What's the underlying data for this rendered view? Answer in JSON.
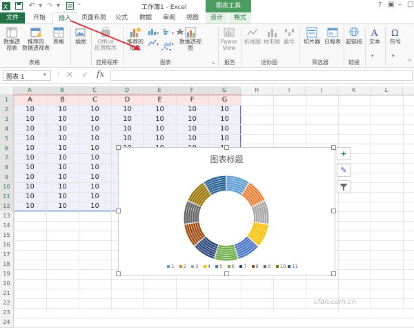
{
  "window": {
    "title": "工作簿1 - Excel",
    "context_tab_title": "图表工具"
  },
  "tabs": [
    "文件",
    "开始",
    "插入",
    "页面布局",
    "公式",
    "数据",
    "审阅",
    "视图",
    "设计",
    "格式"
  ],
  "ribbon": {
    "buttons": {
      "pivot_table": "数据透视表",
      "recommended_pivot_1": "推荐的",
      "recommended_pivot_2": "数据透视表",
      "table": "表格",
      "illustrations": "插图",
      "office_apps_1": "Office",
      "office_apps_2": "应用程序",
      "recommended_charts_1": "推荐的",
      "recommended_charts_2": "图表",
      "pivot_chart": "数据透视图",
      "power_view_1": "Power",
      "power_view_2": "View",
      "sparkline_line": "折线图",
      "sparkline_column": "柱形图",
      "sparkline_winloss": "盈亏",
      "slicer": "切片器",
      "timeline": "日程表",
      "hyperlink": "超链接",
      "text": "文本",
      "symbol": "符号"
    },
    "groups": [
      "表格",
      "应用程序",
      "图表",
      "报告",
      "迷你图",
      "筛选器",
      "链接"
    ]
  },
  "formula_bar": {
    "name_box": "图表 1",
    "fx": "fx"
  },
  "sheet": {
    "columns": [
      "A",
      "B",
      "C",
      "D",
      "E",
      "F",
      "G",
      "H",
      "I",
      "J",
      "K",
      "L"
    ],
    "rows": [
      "1",
      "2",
      "3",
      "4",
      "5",
      "6",
      "7",
      "8",
      "9",
      "10",
      "11",
      "12",
      "13",
      "14",
      "15",
      "16",
      "17",
      "18",
      "19",
      "20",
      "21",
      "22",
      "23",
      "24"
    ],
    "headers": [
      "A",
      "B",
      "C",
      "D",
      "E",
      "F",
      "G"
    ],
    "cell_value": "10"
  },
  "chart": {
    "title": "图表标题",
    "legend": [
      "1",
      "2",
      "3",
      "4",
      "5",
      "6",
      "7",
      "8",
      "9",
      "10",
      "11"
    ],
    "colors": [
      "#5b9bd5",
      "#ed7d31",
      "#a5a5a5",
      "#ffc000",
      "#4472c4",
      "#70ad47",
      "#264478",
      "#9e480e",
      "#636363",
      "#997300",
      "#255e91"
    ]
  },
  "chart_data": {
    "type": "pie",
    "subtype": "doughnut",
    "title": "图表标题",
    "categories": [
      "1",
      "2",
      "3",
      "4",
      "5",
      "6",
      "7",
      "8",
      "9",
      "10",
      "11"
    ],
    "series": [
      {
        "name": "A",
        "values": [
          10,
          10,
          10,
          10,
          10,
          10,
          10,
          10,
          10,
          10,
          10
        ]
      },
      {
        "name": "B",
        "values": [
          10,
          10,
          10,
          10,
          10,
          10,
          10,
          10,
          10,
          10,
          10
        ]
      },
      {
        "name": "C",
        "values": [
          10,
          10,
          10,
          10,
          10,
          10,
          10,
          10,
          10,
          10,
          10
        ]
      },
      {
        "name": "D",
        "values": [
          10,
          10,
          10,
          10,
          10,
          10,
          10,
          10,
          10,
          10,
          10
        ]
      },
      {
        "name": "E",
        "values": [
          10,
          10,
          10,
          10,
          10,
          10,
          10,
          10,
          10,
          10,
          10
        ]
      },
      {
        "name": "F",
        "values": [
          10,
          10,
          10,
          10,
          10,
          10,
          10,
          10,
          10,
          10,
          10
        ]
      },
      {
        "name": "G",
        "values": [
          10,
          10,
          10,
          10,
          10,
          10,
          10,
          10,
          10,
          10,
          10
        ]
      }
    ],
    "legend_position": "bottom"
  },
  "watermark": "cfan.com.cn"
}
